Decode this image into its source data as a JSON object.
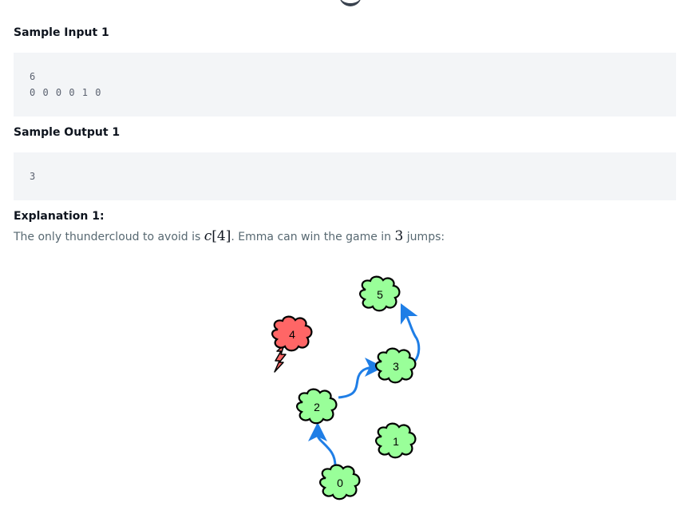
{
  "sample_input": {
    "heading": "Sample Input 1",
    "lines": [
      "6",
      "0 0 0 0 1 0"
    ]
  },
  "sample_output": {
    "heading": "Sample Output 1",
    "lines": [
      "3"
    ]
  },
  "explanation": {
    "heading": "Explanation 1:",
    "text_before": "The only thundercloud to avoid is ",
    "math_var": "c",
    "math_index": "[4]",
    "text_middle": ". Emma can win the game in ",
    "math_jumps": "3",
    "text_after": " jumps:"
  },
  "diagram": {
    "clouds": [
      {
        "label": "0",
        "type": "safe"
      },
      {
        "label": "1",
        "type": "safe"
      },
      {
        "label": "2",
        "type": "safe"
      },
      {
        "label": "3",
        "type": "safe"
      },
      {
        "label": "4",
        "type": "thunder"
      },
      {
        "label": "5",
        "type": "safe"
      }
    ],
    "jumps": [
      [
        "0",
        "2"
      ],
      [
        "2",
        "3"
      ],
      [
        "3",
        "5"
      ]
    ],
    "colors": {
      "safe_fill": "#99ff99",
      "thunder_fill": "#ff6666",
      "arrow": "#1f7ee6",
      "outline": "#000000"
    }
  }
}
